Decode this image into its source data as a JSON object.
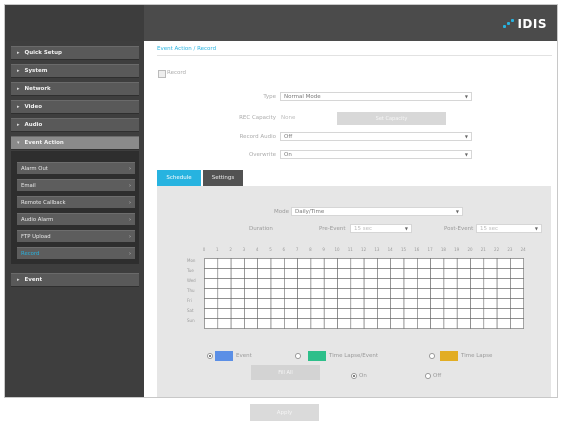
{
  "header": {
    "logo_text": "IDIS",
    "accent_color": "#27b3e0"
  },
  "sidebar": {
    "items": [
      {
        "label": "Quick Setup"
      },
      {
        "label": "System"
      },
      {
        "label": "Network"
      },
      {
        "label": "Video"
      },
      {
        "label": "Audio"
      },
      {
        "label": "Event Action"
      },
      {
        "label": "Event"
      }
    ],
    "subitems": [
      {
        "label": "Alarm Out"
      },
      {
        "label": "Email"
      },
      {
        "label": "Remote Callback"
      },
      {
        "label": "Audio Alarm"
      },
      {
        "label": "FTP Upload"
      },
      {
        "label": "Record"
      }
    ],
    "active_subitem": "Record"
  },
  "breadcrumb": "Event Action / Record",
  "record": {
    "checkbox_label": "Record",
    "checked": false,
    "type_label": "Type",
    "type_value": "Normal Mode",
    "rec_capacity_label": "REC Capacity",
    "rec_capacity_value": "None",
    "rec_capacity_button": "Set Capacity",
    "record_audio_label": "Record Audio",
    "record_audio_value": "Off",
    "overwrite_label": "Overwrite",
    "overwrite_value": "On"
  },
  "tabs": [
    {
      "label": "Schedule"
    },
    {
      "label": "Settings"
    }
  ],
  "schedule": {
    "mode_label": "Mode",
    "mode_value": "Daily/Time",
    "duration_label": "Duration",
    "pre_event_label": "Pre-Event",
    "pre_event_value": "15 sec",
    "post_event_label": "Post-Event",
    "post_event_value": "15 sec",
    "hours": [
      "0",
      "1",
      "2",
      "3",
      "4",
      "5",
      "6",
      "7",
      "8",
      "9",
      "10",
      "11",
      "12",
      "13",
      "14",
      "15",
      "16",
      "17",
      "18",
      "19",
      "20",
      "21",
      "22",
      "23",
      "24"
    ],
    "days": [
      "Mon",
      "Tue",
      "Wed",
      "Thu",
      "Fri",
      "Sat",
      "Sun"
    ],
    "legend": [
      {
        "label": "Event",
        "color": "#5b8fe6",
        "selected": true
      },
      {
        "label": "Time Lapse/Event",
        "color": "#2dbf8a",
        "selected": false
      },
      {
        "label": "Time Lapse",
        "color": "#e2ad23",
        "selected": false
      }
    ],
    "fill_all_button": "Fill All",
    "on_label": "On",
    "off_label": "Off",
    "on_selected": true
  },
  "footer": {
    "apply_label": "Apply"
  }
}
